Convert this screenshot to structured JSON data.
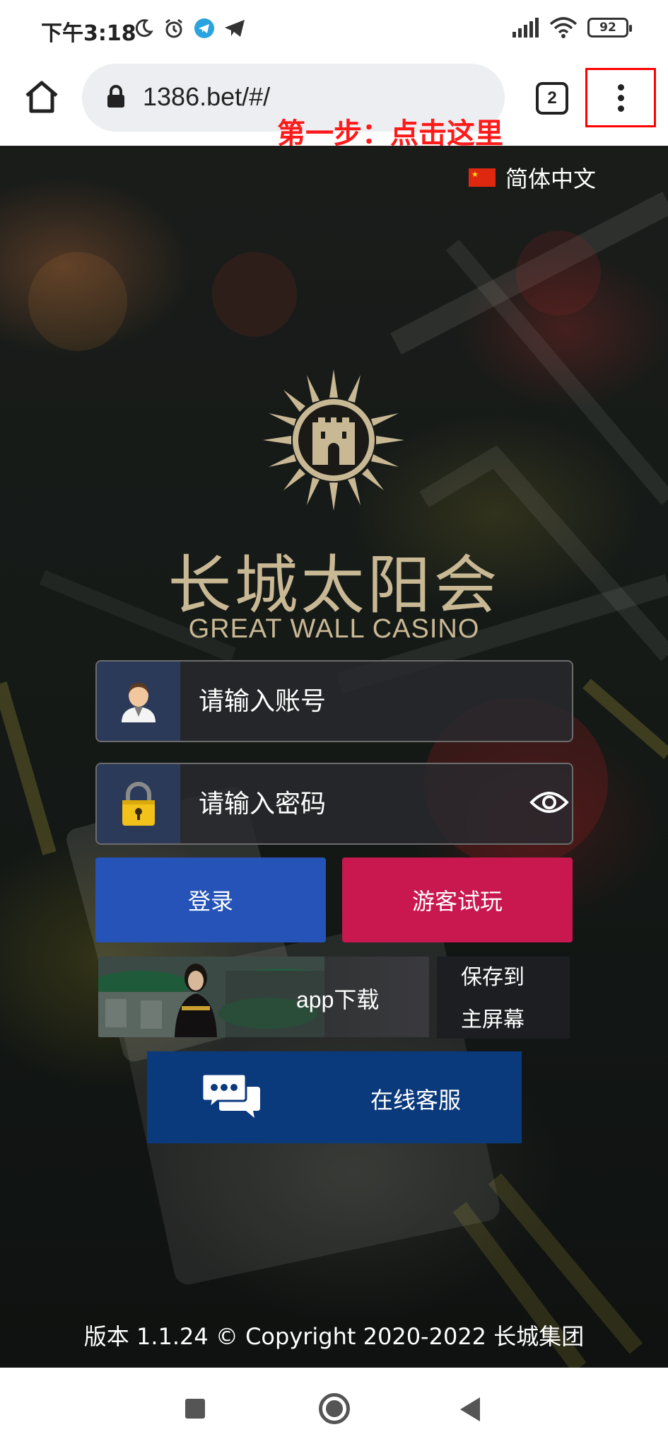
{
  "status_bar": {
    "time": "下午3:18",
    "battery": "92"
  },
  "browser": {
    "url": "1386.bet/#/",
    "tab_count": "2",
    "annotation": "第一步：点击这里"
  },
  "page": {
    "language": "简体中文",
    "brand_title": "长城太阳会",
    "brand_subtitle": "GREAT WALL CASINO",
    "username_placeholder": "请输入账号",
    "password_placeholder": "请输入密码",
    "login_label": "登录",
    "guest_label": "游客试玩",
    "app_download_label": "app下载",
    "save_home_line1": "保存到",
    "save_home_line2": "主屏幕",
    "support_label": "在线客服",
    "footer": "版本 1.1.24 © Copyright 2020-2022 长城集团"
  },
  "colors": {
    "annotation": "#ff1a1a",
    "login": "#2553b8",
    "guest": "#c9174f",
    "support": "#0a3a7c",
    "brand_gold": "#c9b894"
  },
  "icons": {
    "status_left": [
      "moon-icon",
      "alarm-icon",
      "telegram-icon",
      "send-icon"
    ],
    "status_right": [
      "signal-icon",
      "wifi-icon",
      "battery-icon"
    ]
  }
}
